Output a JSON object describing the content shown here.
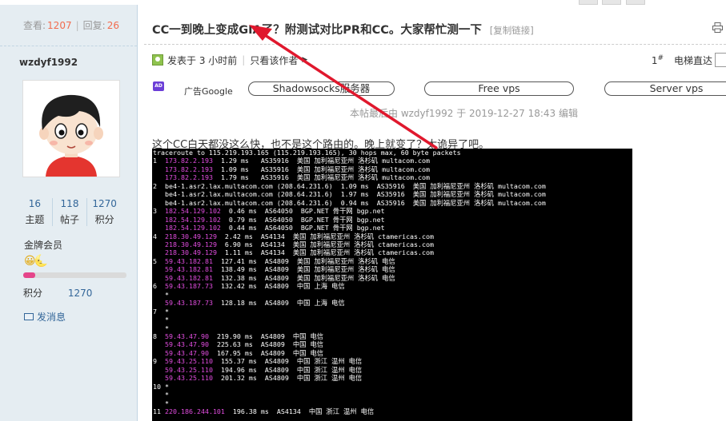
{
  "sidebar": {
    "views_label": "查看:",
    "views_count": "1207",
    "replies_label": "回复:",
    "replies_count": "26",
    "username": "wzdyf1992",
    "stats": [
      {
        "value": "16",
        "label": "主题"
      },
      {
        "value": "118",
        "label": "帖子"
      },
      {
        "value": "1270",
        "label": "积分"
      }
    ],
    "rank": "金牌会员",
    "medals": "😀🌜",
    "progress_fraction": 0.12,
    "credit_label": "积分",
    "credit_value": "1270",
    "send_message": "发消息"
  },
  "post": {
    "title": "CC一到晚上变成GIA了？附测试对比PR和CC。大家帮忙测一下",
    "copy_link": "[复制链接]",
    "posted_at": "发表于 3 小时前",
    "author_only": "只看该作者",
    "floor": "1#",
    "goto": "电梯直达",
    "ad_label": "广告Google",
    "ad_pills": [
      "Shadowsocks服务器",
      "Free vps",
      "Server vps"
    ],
    "edit_note": "本帖最后由 wzdyf1992 于 2019-12-27 18:43 编辑",
    "body": "这个CC白天都没这么快，也不是这个路由的。晚上就变了？太诡异了吧。"
  },
  "terminal": {
    "lines": [
      {
        "indent": "",
        "ip": "",
        "text": "traceroute to 115.219.193.165 (115.219.193.165), 30 hops max, 60 byte packets"
      },
      {
        "indent": "1  ",
        "ip": "173.82.2.193",
        "text": "  1.29 ms   AS35916  美国 加利福尼亚州 洛杉矶 multacom.com"
      },
      {
        "indent": "   ",
        "ip": "173.82.2.193",
        "text": "  1.09 ms   AS35916  美国 加利福尼亚州 洛杉矶 multacom.com"
      },
      {
        "indent": "   ",
        "ip": "173.82.2.193",
        "text": "  1.79 ms   AS35916  美国 加利福尼亚州 洛杉矶 multacom.com"
      },
      {
        "indent": "2  ",
        "ip": "",
        "text": "be4-1.asr2.lax.multacom.com (208.64.231.6)  1.09 ms  AS35916  美国 加利福尼亚州 洛杉矶 multacom.com"
      },
      {
        "indent": "   ",
        "ip": "",
        "text": "be4-1.asr2.lax.multacom.com (208.64.231.6)  1.97 ms  AS35916  美国 加利福尼亚州 洛杉矶 multacom.com"
      },
      {
        "indent": "   ",
        "ip": "",
        "text": "be4-1.asr2.lax.multacom.com (208.64.231.6)  0.94 ms  AS35916  美国 加利福尼亚州 洛杉矶 multacom.com"
      },
      {
        "indent": "3  ",
        "ip": "182.54.129.102",
        "text": "  0.46 ms  AS64050  BGP.NET 骨干网 bgp.net"
      },
      {
        "indent": "   ",
        "ip": "182.54.129.102",
        "text": "  0.79 ms  AS64050  BGP.NET 骨干网 bgp.net"
      },
      {
        "indent": "   ",
        "ip": "182.54.129.102",
        "text": "  0.44 ms  AS64050  BGP.NET 骨干网 bgp.net"
      },
      {
        "indent": "4  ",
        "ip": "218.30.49.129",
        "text": "  2.42 ms  AS4134  美国 加利福尼亚州 洛杉矶 ctamericas.com"
      },
      {
        "indent": "   ",
        "ip": "218.30.49.129",
        "text": "  6.90 ms  AS4134  美国 加利福尼亚州 洛杉矶 ctamericas.com"
      },
      {
        "indent": "   ",
        "ip": "218.30.49.129",
        "text": "  1.11 ms  AS4134  美国 加利福尼亚州 洛杉矶 ctamericas.com"
      },
      {
        "indent": "5  ",
        "ip": "59.43.182.81",
        "text": "  127.41 ms  AS4809  美国 加利福尼亚州 洛杉矶 电信"
      },
      {
        "indent": "   ",
        "ip": "59.43.182.81",
        "text": "  138.49 ms  AS4809  美国 加利福尼亚州 洛杉矶 电信"
      },
      {
        "indent": "   ",
        "ip": "59.43.182.81",
        "text": "  132.38 ms  AS4809  美国 加利福尼亚州 洛杉矶 电信"
      },
      {
        "indent": "6  ",
        "ip": "59.43.187.73",
        "text": "  132.42 ms  AS4809  中国 上海 电信"
      },
      {
        "indent": "   ",
        "ip": "",
        "text": "*"
      },
      {
        "indent": "   ",
        "ip": "59.43.187.73",
        "text": "  128.18 ms  AS4809  中国 上海 电信"
      },
      {
        "indent": "7  ",
        "ip": "",
        "text": "*"
      },
      {
        "indent": "   ",
        "ip": "",
        "text": "*"
      },
      {
        "indent": "   ",
        "ip": "",
        "text": "*"
      },
      {
        "indent": "8  ",
        "ip": "59.43.47.90",
        "text": "  219.90 ms  AS4809  中国 电信"
      },
      {
        "indent": "   ",
        "ip": "59.43.47.90",
        "text": "  225.63 ms  AS4809  中国 电信"
      },
      {
        "indent": "   ",
        "ip": "59.43.47.90",
        "text": "  167.95 ms  AS4809  中国 电信"
      },
      {
        "indent": "9  ",
        "ip": "59.43.25.110",
        "text": "  155.37 ms  AS4809  中国 浙江 温州 电信"
      },
      {
        "indent": "   ",
        "ip": "59.43.25.110",
        "text": "  194.96 ms  AS4809  中国 浙江 温州 电信"
      },
      {
        "indent": "   ",
        "ip": "59.43.25.110",
        "text": "  201.32 ms  AS4809  中国 浙江 温州 电信"
      },
      {
        "indent": "10 ",
        "ip": "",
        "text": "*"
      },
      {
        "indent": "   ",
        "ip": "",
        "text": "*"
      },
      {
        "indent": "   ",
        "ip": "",
        "text": "*"
      },
      {
        "indent": "11 ",
        "ip": "220.186.244.101",
        "text": "  196.38 ms  AS4134  中国 浙江 温州 电信"
      }
    ]
  },
  "colors": {
    "sidebar_bg": "#e5edf2",
    "accent_orange": "#f26c4f",
    "link_blue": "#336699",
    "terminal_ip": "#e24de0",
    "annotation_arrow": "#e0182d"
  },
  "icons": [
    "print-icon",
    "online-status-icon",
    "envelope-icon",
    "ad-badge-icon"
  ]
}
